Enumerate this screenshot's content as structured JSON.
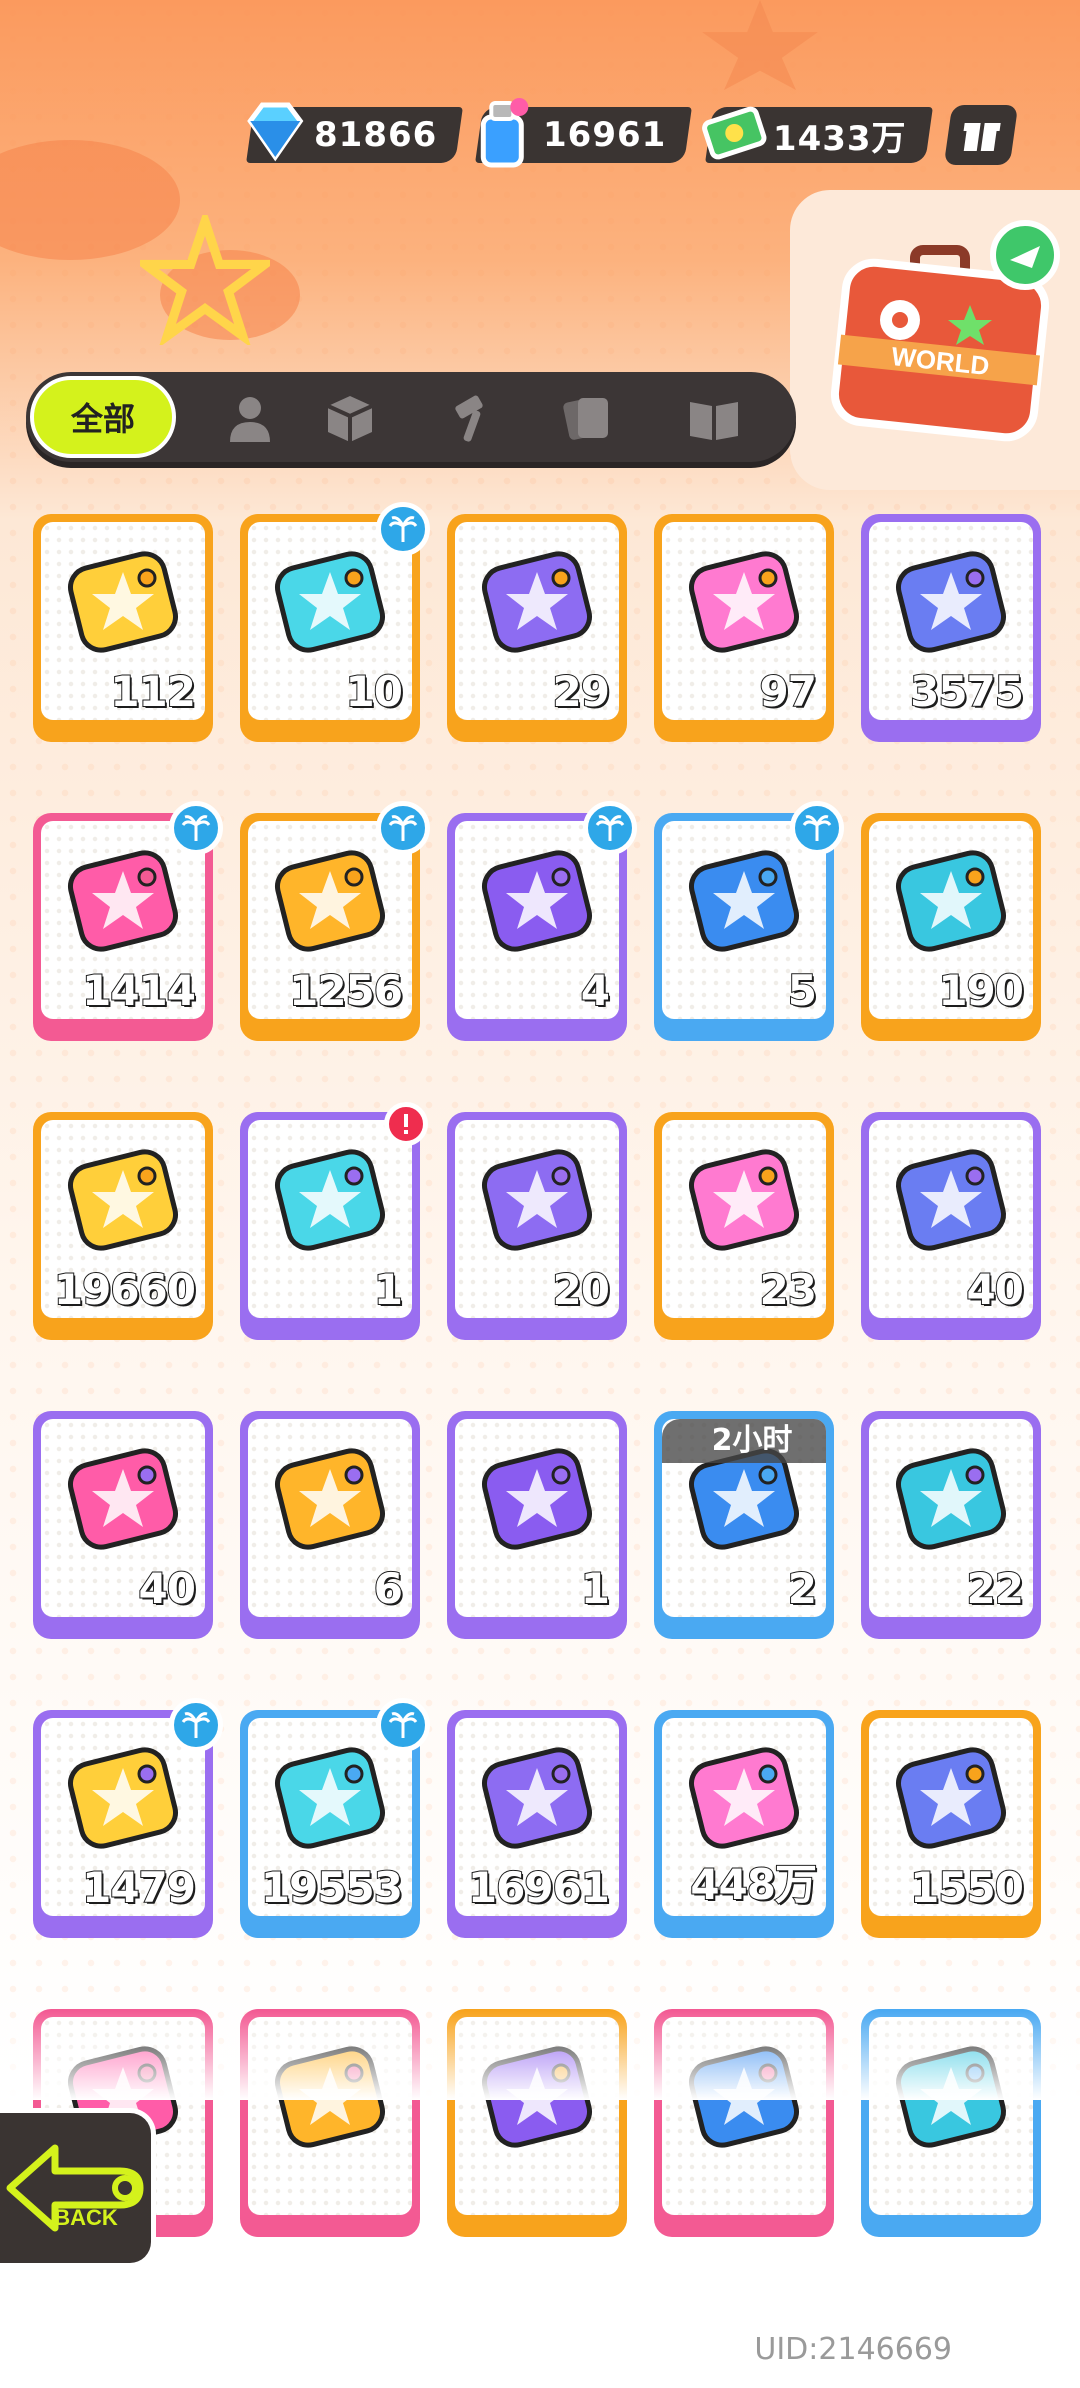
{
  "currencies": [
    {
      "icon": "diamond-icon",
      "value": "81866"
    },
    {
      "icon": "spray-can-icon",
      "value": "16961"
    },
    {
      "icon": "cash-icon",
      "value": "1433万"
    }
  ],
  "header": {
    "gift_icon": "gift-box-icon",
    "world_icon": "world-suitcase-icon",
    "world_label": "WORLD"
  },
  "tabs": {
    "active_label": "全部",
    "icons": [
      "person-icon",
      "box-icon",
      "hammer-icon",
      "cards-icon",
      "book-icon"
    ]
  },
  "items": [
    {
      "icon": "star-ticket-icon",
      "count": "112",
      "color": "orange",
      "badge": ""
    },
    {
      "icon": "wave-ticket-icon",
      "count": "10",
      "color": "orange",
      "badge": "palm"
    },
    {
      "icon": "purple-ticket-icon",
      "count": "29",
      "color": "orange",
      "badge": ""
    },
    {
      "icon": "rainbow-star-icon",
      "count": "97",
      "color": "orange",
      "badge": ""
    },
    {
      "icon": "purple-star-icon",
      "count": "3575",
      "color": "purple",
      "badge": ""
    },
    {
      "icon": "pink-crayon-icon",
      "count": "1414",
      "color": "pink",
      "badge": "palm"
    },
    {
      "icon": "yellow-crayon-icon",
      "count": "1256",
      "color": "orange",
      "badge": "palm"
    },
    {
      "icon": "purple-crayon-icon",
      "count": "4",
      "color": "purple",
      "badge": "palm"
    },
    {
      "icon": "blue-crayon-icon",
      "count": "5",
      "color": "blue",
      "badge": "palm"
    },
    {
      "icon": "color-cube-icon",
      "count": "190",
      "color": "orange",
      "badge": ""
    },
    {
      "icon": "season-ticket-icon",
      "count": "19660",
      "color": "orange",
      "badge": ""
    },
    {
      "icon": "travel-card-icon",
      "count": "1",
      "color": "purple",
      "badge": "alert"
    },
    {
      "icon": "mystery-egg-icon",
      "count": "20",
      "color": "purple",
      "badge": ""
    },
    {
      "icon": "gold-deity-icon",
      "count": "23",
      "color": "orange",
      "badge": ""
    },
    {
      "icon": "purple-deity-icon",
      "count": "40",
      "color": "purple",
      "badge": ""
    },
    {
      "icon": "travel-card-stack-icon",
      "count": "40",
      "color": "purple",
      "badge": ""
    },
    {
      "icon": "fish-bubble-icon",
      "count": "6",
      "color": "purple",
      "badge": ""
    },
    {
      "icon": "piranha-bubble-icon",
      "count": "1",
      "color": "purple",
      "badge": ""
    },
    {
      "icon": "alarm-clock-icon",
      "count": "2",
      "color": "blue",
      "badge": "",
      "timer": "2小时"
    },
    {
      "icon": "green-drink-icon",
      "count": "22",
      "color": "purple",
      "badge": ""
    },
    {
      "icon": "blue-spray-can-icon",
      "count": "1479",
      "color": "purple",
      "badge": "palm"
    },
    {
      "icon": "paint-tube-icon",
      "count": "19553",
      "color": "blue",
      "badge": "palm"
    },
    {
      "icon": "pink-spray-can-icon",
      "count": "16961",
      "color": "purple",
      "badge": ""
    },
    {
      "icon": "rainbow-tube-icon",
      "count": "448万",
      "color": "blue",
      "badge": ""
    },
    {
      "icon": "gold-gem-icon",
      "count": "1550",
      "color": "orange",
      "badge": ""
    },
    {
      "icon": "partial-item-icon",
      "count": "",
      "color": "pink",
      "badge": ""
    },
    {
      "icon": "partial-item-icon",
      "count": "",
      "color": "pink",
      "badge": ""
    },
    {
      "icon": "partial-item-icon",
      "count": "",
      "color": "orange",
      "badge": ""
    },
    {
      "icon": "partial-item-icon",
      "count": "",
      "color": "pink",
      "badge": ""
    },
    {
      "icon": "partial-item-icon",
      "count": "",
      "color": "blue",
      "badge": ""
    }
  ],
  "back_label": "BACK",
  "uid": "UID:2146669"
}
